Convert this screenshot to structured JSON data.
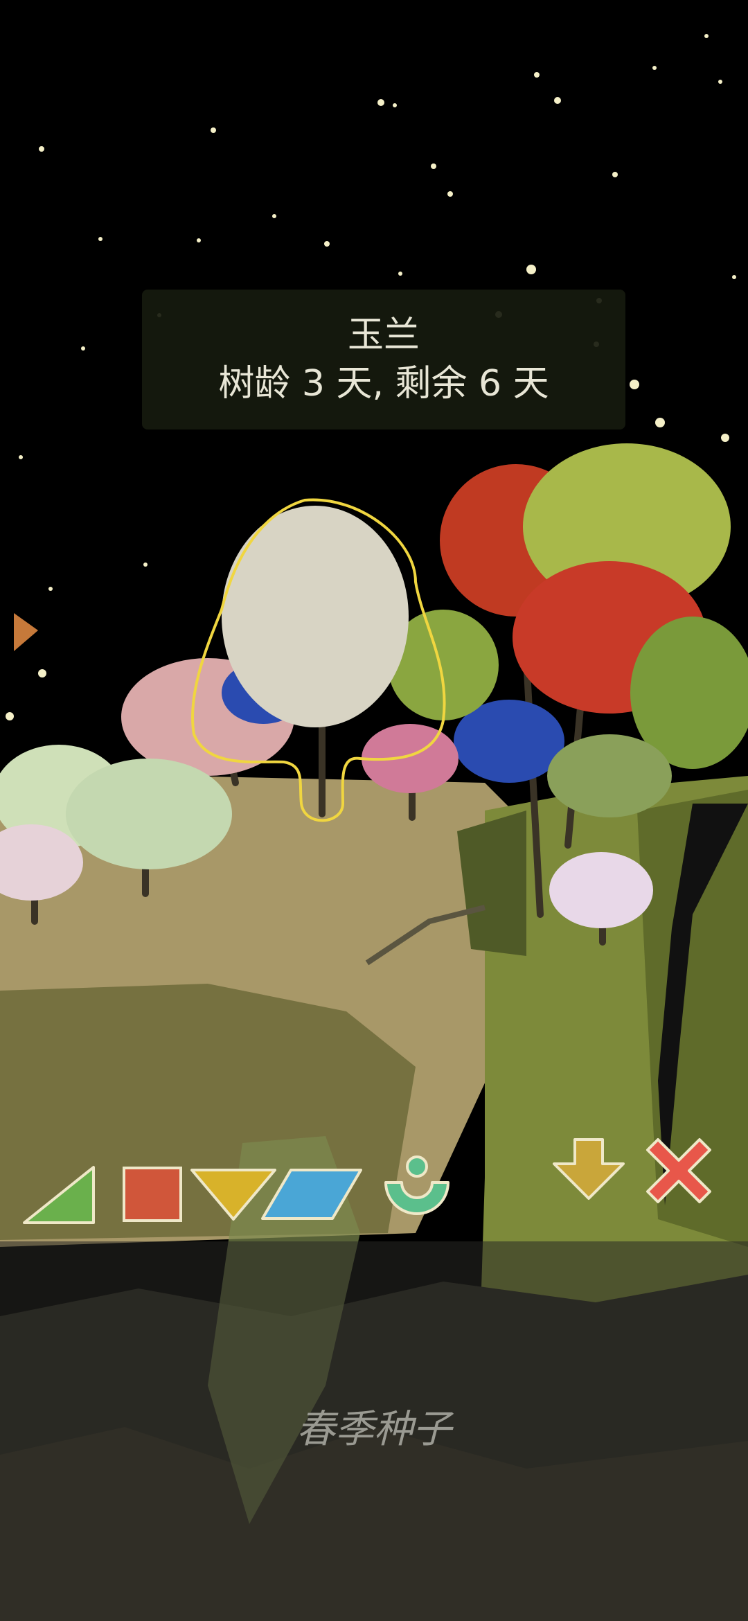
{
  "tree_info": {
    "name": "玉兰",
    "age_text": "树龄 3 天, 剩余 6 天"
  },
  "bottom_panel": {
    "label": "春季种子"
  },
  "toolbar": {
    "tools": [
      {
        "icon": "green-triangle-icon",
        "color": "#6ab04c"
      },
      {
        "icon": "red-square-icon",
        "color": "#d0563a"
      },
      {
        "icon": "yellow-triangle-icon",
        "color": "#d8b22a"
      },
      {
        "icon": "blue-parallelogram-icon",
        "color": "#4aa6d6"
      },
      {
        "icon": "seed-bowl-icon",
        "color": "#5bbf8c"
      }
    ],
    "actions": [
      {
        "icon": "down-arrow-icon",
        "color": "#c9a63a"
      },
      {
        "icon": "close-x-icon",
        "color": "#e8574a"
      }
    ]
  },
  "colors": {
    "ground": "#a89868",
    "cliff": "#7d8a3a",
    "outline": "#f0d640"
  }
}
